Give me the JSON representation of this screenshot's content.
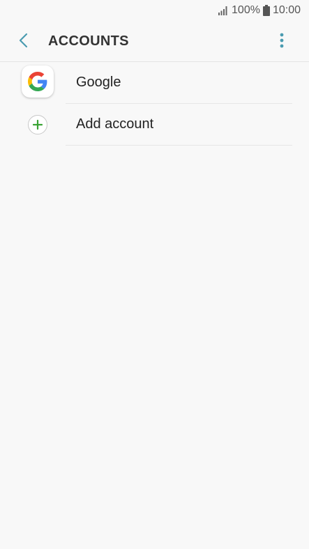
{
  "status_bar": {
    "battery_percent": "100%",
    "time": "10:00",
    "signal_icon": "signal-icon",
    "battery_icon": "battery-icon"
  },
  "app_bar": {
    "title": "ACCOUNTS",
    "back_icon": "chevron-left-icon",
    "more_icon": "more-vert-icon",
    "accent_color": "#4a9bb0"
  },
  "accounts": [
    {
      "label": "Google",
      "icon": "google-icon"
    },
    {
      "label": "Add account",
      "icon": "plus-icon",
      "icon_color": "#3aa335"
    }
  ]
}
